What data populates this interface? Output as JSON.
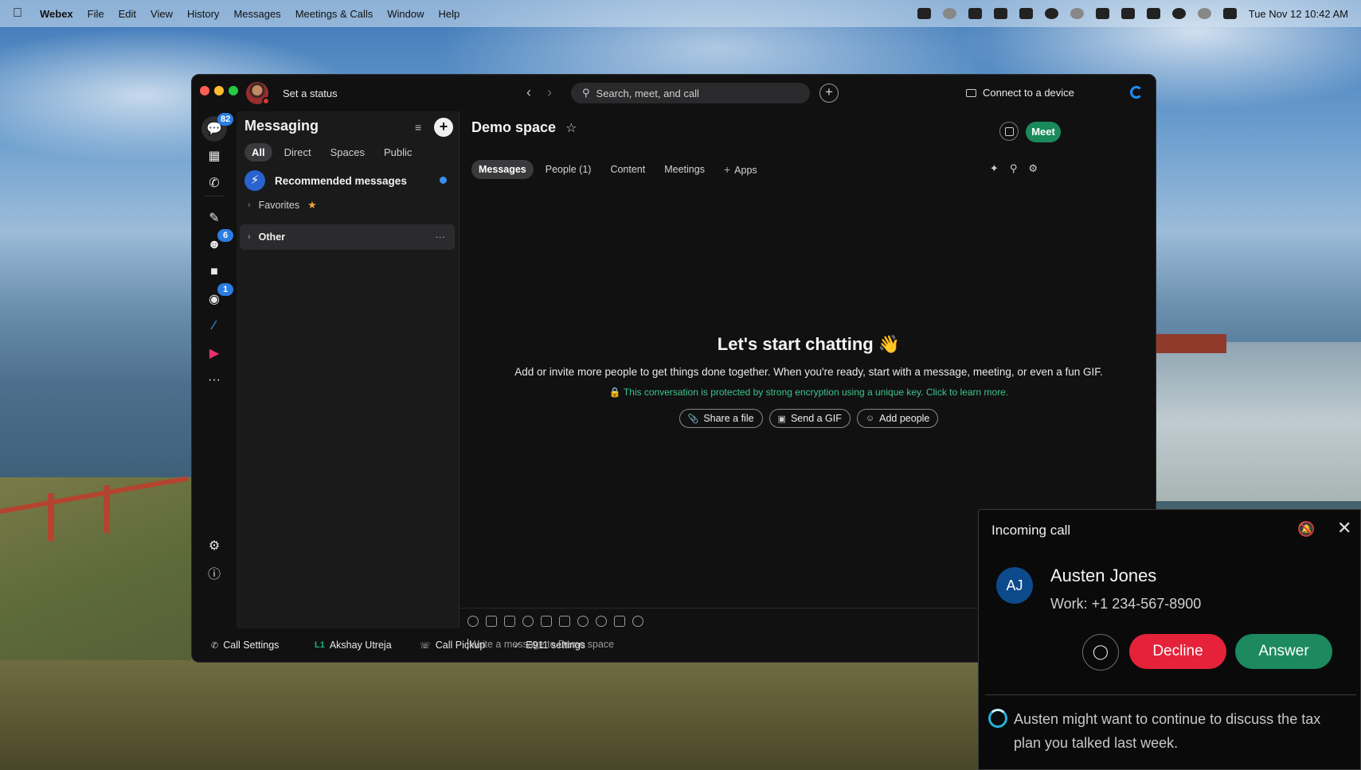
{
  "menubar": {
    "app_name": "Webex",
    "items": [
      "File",
      "Edit",
      "View",
      "History",
      "Messages",
      "Meetings & Calls",
      "Window",
      "Help"
    ],
    "clock": "Tue Nov 12  10:42 AM"
  },
  "titlebar": {
    "status": "Set a status",
    "search_placeholder": "Search, meet, and call",
    "connect": "Connect to a device"
  },
  "rail": {
    "messaging_badge": "82",
    "teams_badge": "6",
    "voicemail_badge": "1",
    "more": "···"
  },
  "messaging": {
    "title": "Messaging",
    "filters": [
      "All",
      "Direct",
      "Spaces",
      "Public"
    ],
    "recommended": "Recommended messages",
    "favorites": "Favorites",
    "other": "Other",
    "other_more": "···"
  },
  "space": {
    "title": "Demo space",
    "meet": "Meet",
    "tabs": [
      "Messages",
      "People (1)",
      "Content",
      "Meetings",
      "Apps"
    ],
    "empty_title": "Let's start chatting 👋",
    "empty_subtitle": "Add or invite more people to get things done together. When you're ready, start with a message, meeting, or even a fun GIF.",
    "encryption": "🔒 This conversation is protected by strong encryption using a unique key. Click to learn more.",
    "actions": [
      "Share a file",
      "Send a GIF",
      "Add people"
    ],
    "composer_placeholder": "Write a message to Demo space"
  },
  "footer": {
    "call_settings": "Call Settings",
    "line_tag": "L1",
    "line_user": "Akshay Utreja",
    "call_pickup": "Call Pickup",
    "e911": "E911 settings"
  },
  "incoming_call": {
    "title": "Incoming call",
    "initials": "AJ",
    "name": "Austen Jones",
    "number": "Work: +1 234-567-8900",
    "decline": "Decline",
    "answer": "Answer",
    "ai_hint": "Austen might want to continue to discuss the tax plan you talked last week."
  },
  "colors": {
    "accent_green": "#1c8a5e",
    "decline_red": "#e5223a",
    "badge_blue": "#2a7de1",
    "encryption_green": "#3fc48a"
  }
}
